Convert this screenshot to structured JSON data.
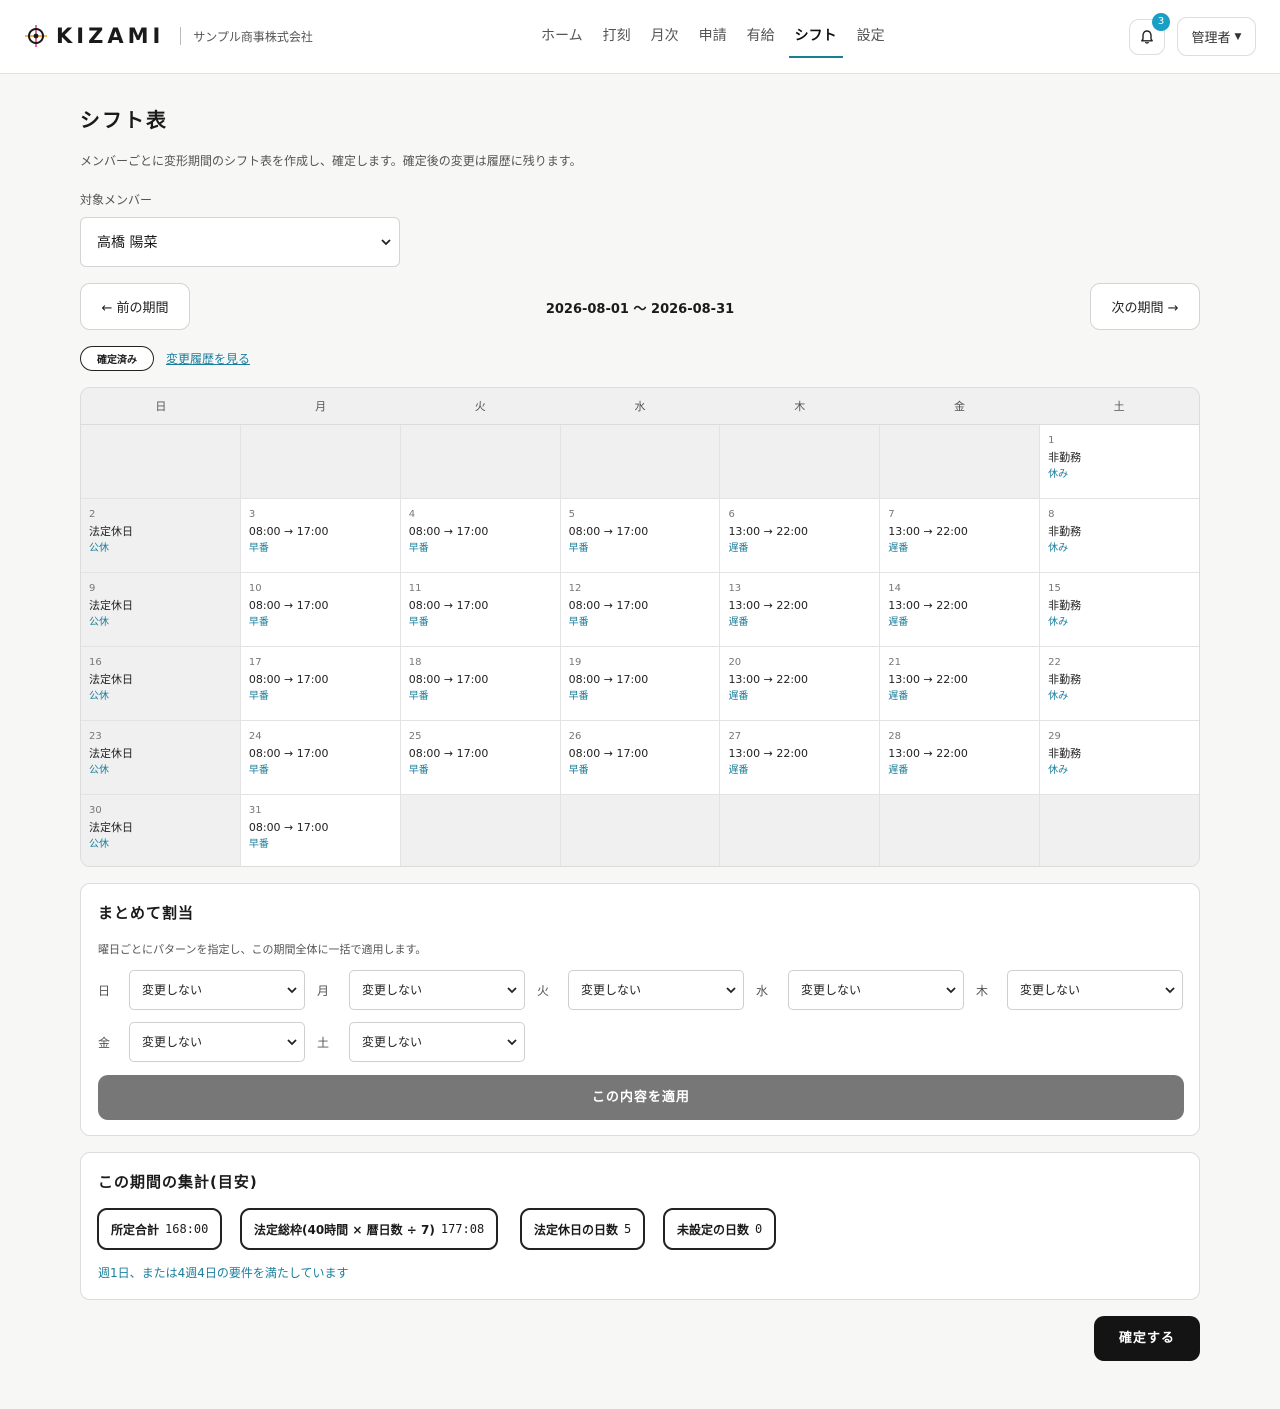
{
  "header": {
    "logo": "KIZAMI",
    "company": "サンプル商事株式会社",
    "nav": [
      "ホーム",
      "打刻",
      "月次",
      "申請",
      "有給",
      "シフト",
      "設定"
    ],
    "active_nav": "シフト",
    "notification_count": "3",
    "admin_label": "管理者"
  },
  "page": {
    "title": "シフト表",
    "description": "メンバーごとに変形期間のシフト表を作成し、確定します。確定後の変更は履歴に残ります。",
    "member_label": "対象メンバー",
    "member_value": "高橋 陽菜",
    "prev_period": "← 前の期間",
    "next_period": "次の期間 →",
    "period_range": "2026-08-01 〜 2026-08-31",
    "status": "確定済み",
    "history_link": "変更履歴を見る"
  },
  "calendar": {
    "weekdays": [
      "日",
      "月",
      "火",
      "水",
      "木",
      "金",
      "土"
    ],
    "weeks": [
      [
        null,
        null,
        null,
        null,
        null,
        null,
        {
          "day": "1",
          "text": "非勤務",
          "pattern": "休み"
        }
      ],
      [
        {
          "day": "2",
          "text": "法定休日",
          "pattern": "公休"
        },
        {
          "day": "3",
          "text": "08:00 → 17:00",
          "pattern": "早番"
        },
        {
          "day": "4",
          "text": "08:00 → 17:00",
          "pattern": "早番"
        },
        {
          "day": "5",
          "text": "08:00 → 17:00",
          "pattern": "早番"
        },
        {
          "day": "6",
          "text": "13:00 → 22:00",
          "pattern": "遅番"
        },
        {
          "day": "7",
          "text": "13:00 → 22:00",
          "pattern": "遅番"
        },
        {
          "day": "8",
          "text": "非勤務",
          "pattern": "休み"
        }
      ],
      [
        {
          "day": "9",
          "text": "法定休日",
          "pattern": "公休"
        },
        {
          "day": "10",
          "text": "08:00 → 17:00",
          "pattern": "早番"
        },
        {
          "day": "11",
          "text": "08:00 → 17:00",
          "pattern": "早番"
        },
        {
          "day": "12",
          "text": "08:00 → 17:00",
          "pattern": "早番"
        },
        {
          "day": "13",
          "text": "13:00 → 22:00",
          "pattern": "遅番"
        },
        {
          "day": "14",
          "text": "13:00 → 22:00",
          "pattern": "遅番"
        },
        {
          "day": "15",
          "text": "非勤務",
          "pattern": "休み"
        }
      ],
      [
        {
          "day": "16",
          "text": "法定休日",
          "pattern": "公休"
        },
        {
          "day": "17",
          "text": "08:00 → 17:00",
          "pattern": "早番"
        },
        {
          "day": "18",
          "text": "08:00 → 17:00",
          "pattern": "早番"
        },
        {
          "day": "19",
          "text": "08:00 → 17:00",
          "pattern": "早番"
        },
        {
          "day": "20",
          "text": "13:00 → 22:00",
          "pattern": "遅番"
        },
        {
          "day": "21",
          "text": "13:00 → 22:00",
          "pattern": "遅番"
        },
        {
          "day": "22",
          "text": "非勤務",
          "pattern": "休み"
        }
      ],
      [
        {
          "day": "23",
          "text": "法定休日",
          "pattern": "公休"
        },
        {
          "day": "24",
          "text": "08:00 → 17:00",
          "pattern": "早番"
        },
        {
          "day": "25",
          "text": "08:00 → 17:00",
          "pattern": "早番"
        },
        {
          "day": "26",
          "text": "08:00 → 17:00",
          "pattern": "早番"
        },
        {
          "day": "27",
          "text": "13:00 → 22:00",
          "pattern": "遅番"
        },
        {
          "day": "28",
          "text": "13:00 → 22:00",
          "pattern": "遅番"
        },
        {
          "day": "29",
          "text": "非勤務",
          "pattern": "休み"
        }
      ],
      [
        {
          "day": "30",
          "text": "法定休日",
          "pattern": "公休"
        },
        {
          "day": "31",
          "text": "08:00 → 17:00",
          "pattern": "早番"
        },
        null,
        null,
        null,
        null,
        null
      ]
    ]
  },
  "bulk": {
    "title": "まとめて割当",
    "description": "曜日ごとにパターンを指定し、この期間全体に一括で適用します。",
    "days": [
      "日",
      "月",
      "火",
      "水",
      "木",
      "金",
      "土"
    ],
    "option": "変更しない",
    "apply": "この内容を適用"
  },
  "summary": {
    "title": "この期間の集計(目安)",
    "chips": [
      {
        "label": "所定合計",
        "value": "168:00"
      },
      {
        "label": "法定総枠(40時間 × 暦日数 ÷ 7)",
        "value": "177:08"
      },
      {
        "label": "法定休日の日数",
        "value": "5"
      },
      {
        "label": "未設定の日数",
        "value": "0"
      }
    ],
    "note": "週1日、または4週4日の要件を満たしています"
  },
  "confirm": "確定する",
  "colors": {
    "accent": "#1a7f9e",
    "badge": "#1a9fc4",
    "primary": "#141414"
  }
}
